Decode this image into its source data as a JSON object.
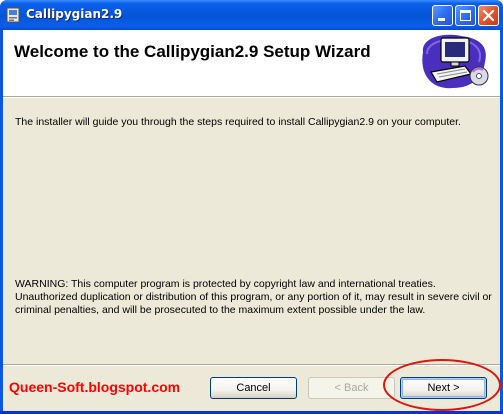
{
  "window": {
    "title": "Callipygian2.9",
    "controls": {
      "minimize": "minimize-icon",
      "maximize": "maximize-icon",
      "close": "close-icon"
    }
  },
  "header": {
    "title": "Welcome to the Callipygian2.9 Setup Wizard",
    "art": "computer-setup-icon"
  },
  "content": {
    "intro": "The installer will guide you through the steps required to install Callipygian2.9 on your computer.",
    "warning": "WARNING: This computer program is protected by copyright law and international treaties. Unauthorized duplication or distribution of this program, or any portion of it, may result in severe civil or criminal penalties, and will be prosecuted to the maximum extent possible under the law."
  },
  "footer": {
    "watermark": "Queen-Soft.blogspot.com",
    "cancel_label": "Cancel",
    "back_label": "< Back",
    "next_label": "Next >"
  },
  "colors": {
    "titlebar": "#0554d8",
    "dialog_bg": "#ece9d8",
    "watermark": "#ff0000",
    "annotation_circle": "#e0130f"
  }
}
